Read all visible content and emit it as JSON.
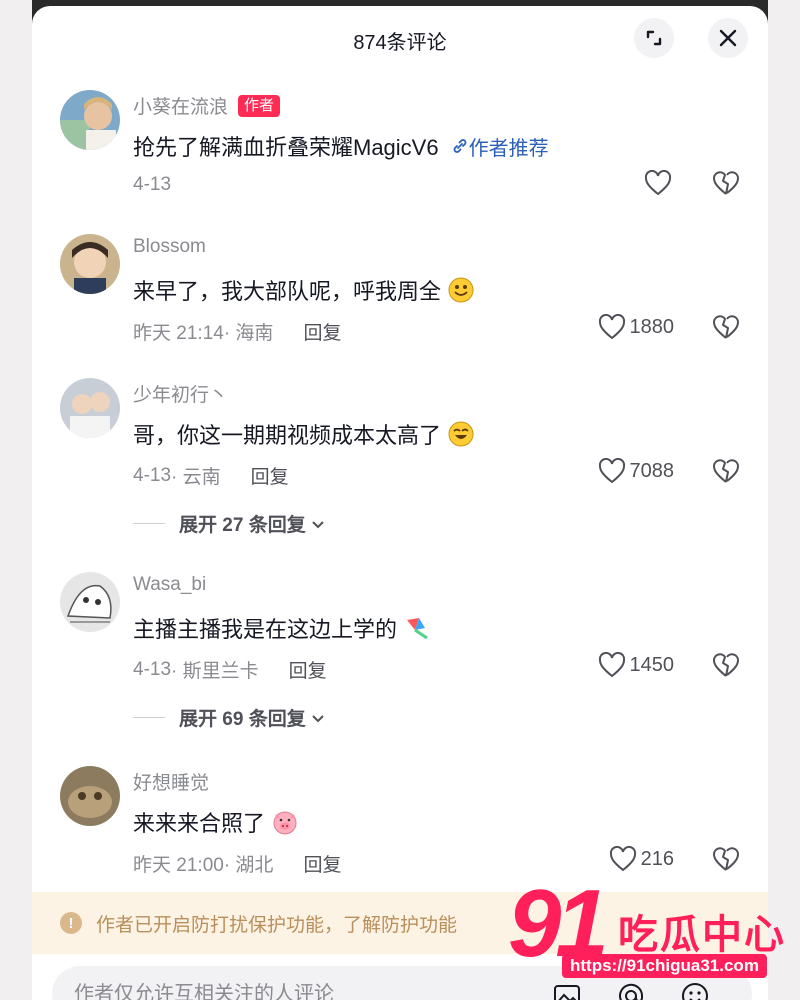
{
  "header": {
    "title": "874条评论"
  },
  "comments": [
    {
      "username": "小葵在流浪",
      "author_tag": "作者",
      "text": "抢先了解满血折叠荣耀MagicV6",
      "recommend": "作者推荐",
      "date": "4-13",
      "location": "",
      "reply": "",
      "likes": ""
    },
    {
      "username": "Blossom",
      "text": "来早了，我大部队呢，呼我周全",
      "date": "昨天 21:14",
      "location": "· 海南",
      "reply": "回复",
      "likes": "1880"
    },
    {
      "username": "少年初行丶",
      "text": "哥，你这一期期视频成本太高了",
      "date": "4-13",
      "location": "· 云南",
      "reply": "回复",
      "likes": "7088",
      "expand": "展开 27 条回复"
    },
    {
      "username": "Wasa_bi",
      "text": "主播主播我是在这边上学的",
      "date": "4-13",
      "location": "· 斯里兰卡",
      "reply": "回复",
      "likes": "1450",
      "expand": "展开 69 条回复"
    },
    {
      "username": "好想睡觉",
      "text": "来来来合照了",
      "date": "昨天 21:00",
      "location": "· 湖北",
      "reply": "回复",
      "likes": "216"
    }
  ],
  "notice": {
    "text": "作者已开启防打扰保护功能，了解防护功能"
  },
  "input": {
    "placeholder": "作者仅允许互相关注的人评论"
  },
  "watermark": {
    "brand": "91",
    "name": "吃瓜中心",
    "url": "https://91chigua31.com"
  },
  "colors": {
    "accent": "#fe2c55",
    "link": "#2b5fb8",
    "notice_bg": "#fdf3e4"
  }
}
